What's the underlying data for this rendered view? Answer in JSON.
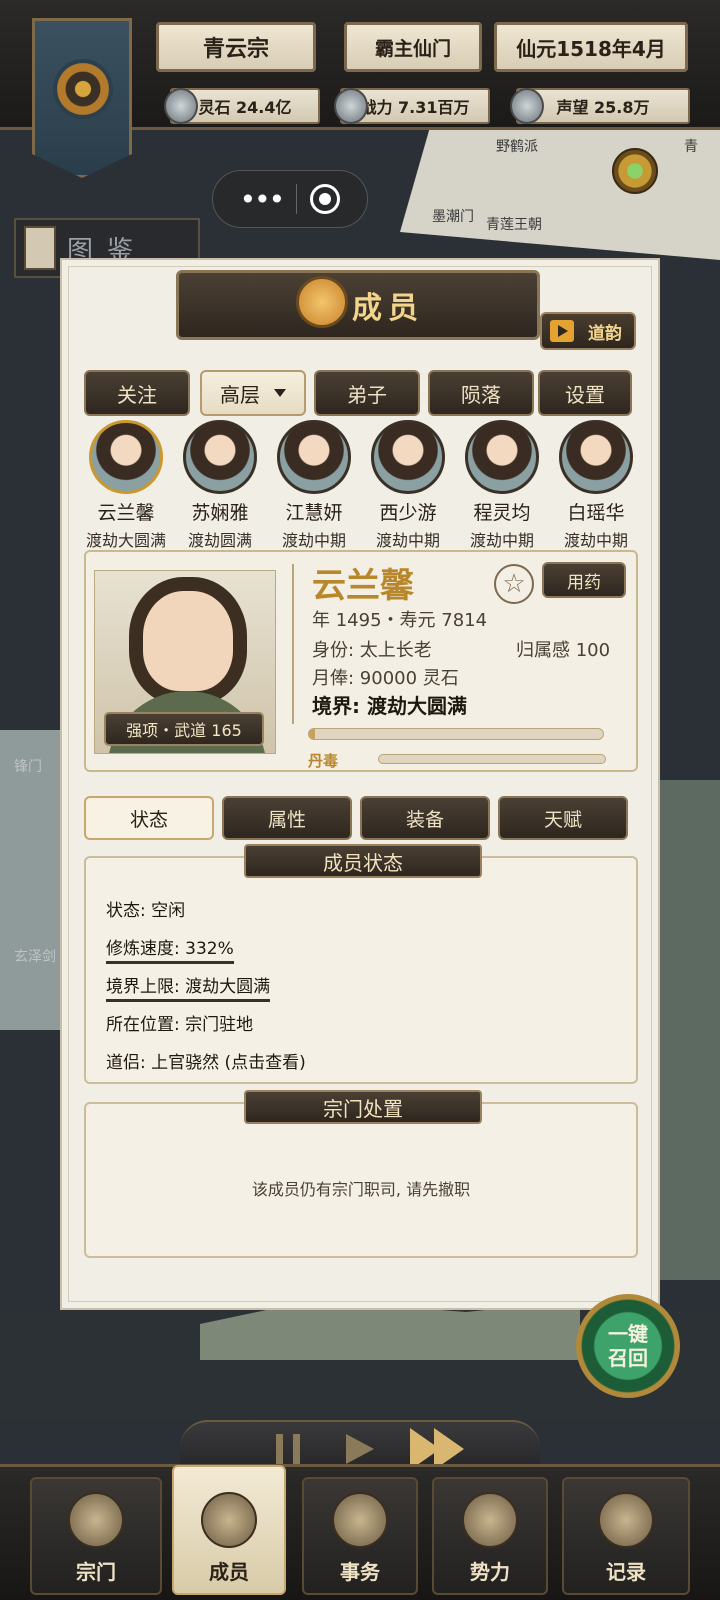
{
  "top": {
    "sect_name": "青云宗",
    "sect_rank": "霸主仙门",
    "date": "仙元1518年4月",
    "resources": [
      {
        "icon": "spirit-stone-icon",
        "label": "灵石 24.4亿"
      },
      {
        "icon": "sword-icon",
        "label": "战力 7.31百万"
      },
      {
        "icon": "orb-icon",
        "label": "声望 25.8万"
      }
    ]
  },
  "map": {
    "places": [
      "野鹤派",
      "墨潮门",
      "青莲王朝",
      "青",
      "锋门",
      "玄泽剑"
    ],
    "tujian": "图鉴"
  },
  "panel": {
    "title": "成员",
    "daoyun": "道韵",
    "tabs": [
      {
        "label": "关注"
      },
      {
        "label": "高层"
      },
      {
        "label": "弟子"
      },
      {
        "label": "陨落"
      },
      {
        "label": "设置"
      }
    ],
    "members": [
      {
        "name": "云兰馨",
        "realm": "渡劫大圆满"
      },
      {
        "name": "苏娴雅",
        "realm": "渡劫圆满"
      },
      {
        "name": "江慧妍",
        "realm": "渡劫中期"
      },
      {
        "name": "西少游",
        "realm": "渡劫中期"
      },
      {
        "name": "程灵均",
        "realm": "渡劫中期"
      },
      {
        "name": "白瑶华",
        "realm": "渡劫中期"
      }
    ],
    "detail": {
      "name": "云兰馨",
      "medicine_button": "用药",
      "strength": "强项・武道 165",
      "age_life": "年 1495・寿元 7814",
      "identity": "身份: 太上长老",
      "belonging": "归属感 100",
      "salary": "月俸: 90000 灵石",
      "realm": "境界: 渡劫大圆满",
      "progress": 0.02,
      "dan_label": "丹毒",
      "dan_poison": 0
    },
    "subtabs": [
      {
        "label": "状态"
      },
      {
        "label": "属性"
      },
      {
        "label": "装备"
      },
      {
        "label": "天赋"
      }
    ],
    "status_section": {
      "title": "成员状态",
      "lines": [
        "状态: 空闲",
        "修炼速度: 332%",
        "境界上限: 渡劫大圆满",
        "所在位置: 宗门驻地",
        "道侣: 上官骁然 (点击查看)"
      ]
    },
    "disposal_section": {
      "title": "宗门处置",
      "notice": "该成员仍有宗门职司, 请先撤职"
    }
  },
  "recall": {
    "line1": "一键",
    "line2": "召回"
  },
  "bottom_nav": [
    {
      "label": "宗门",
      "icon": "sect-icon"
    },
    {
      "label": "成员",
      "icon": "member-icon"
    },
    {
      "label": "事务",
      "icon": "scroll-icon"
    },
    {
      "label": "势力",
      "icon": "banner-icon"
    },
    {
      "label": "记录",
      "icon": "book-icon"
    }
  ]
}
